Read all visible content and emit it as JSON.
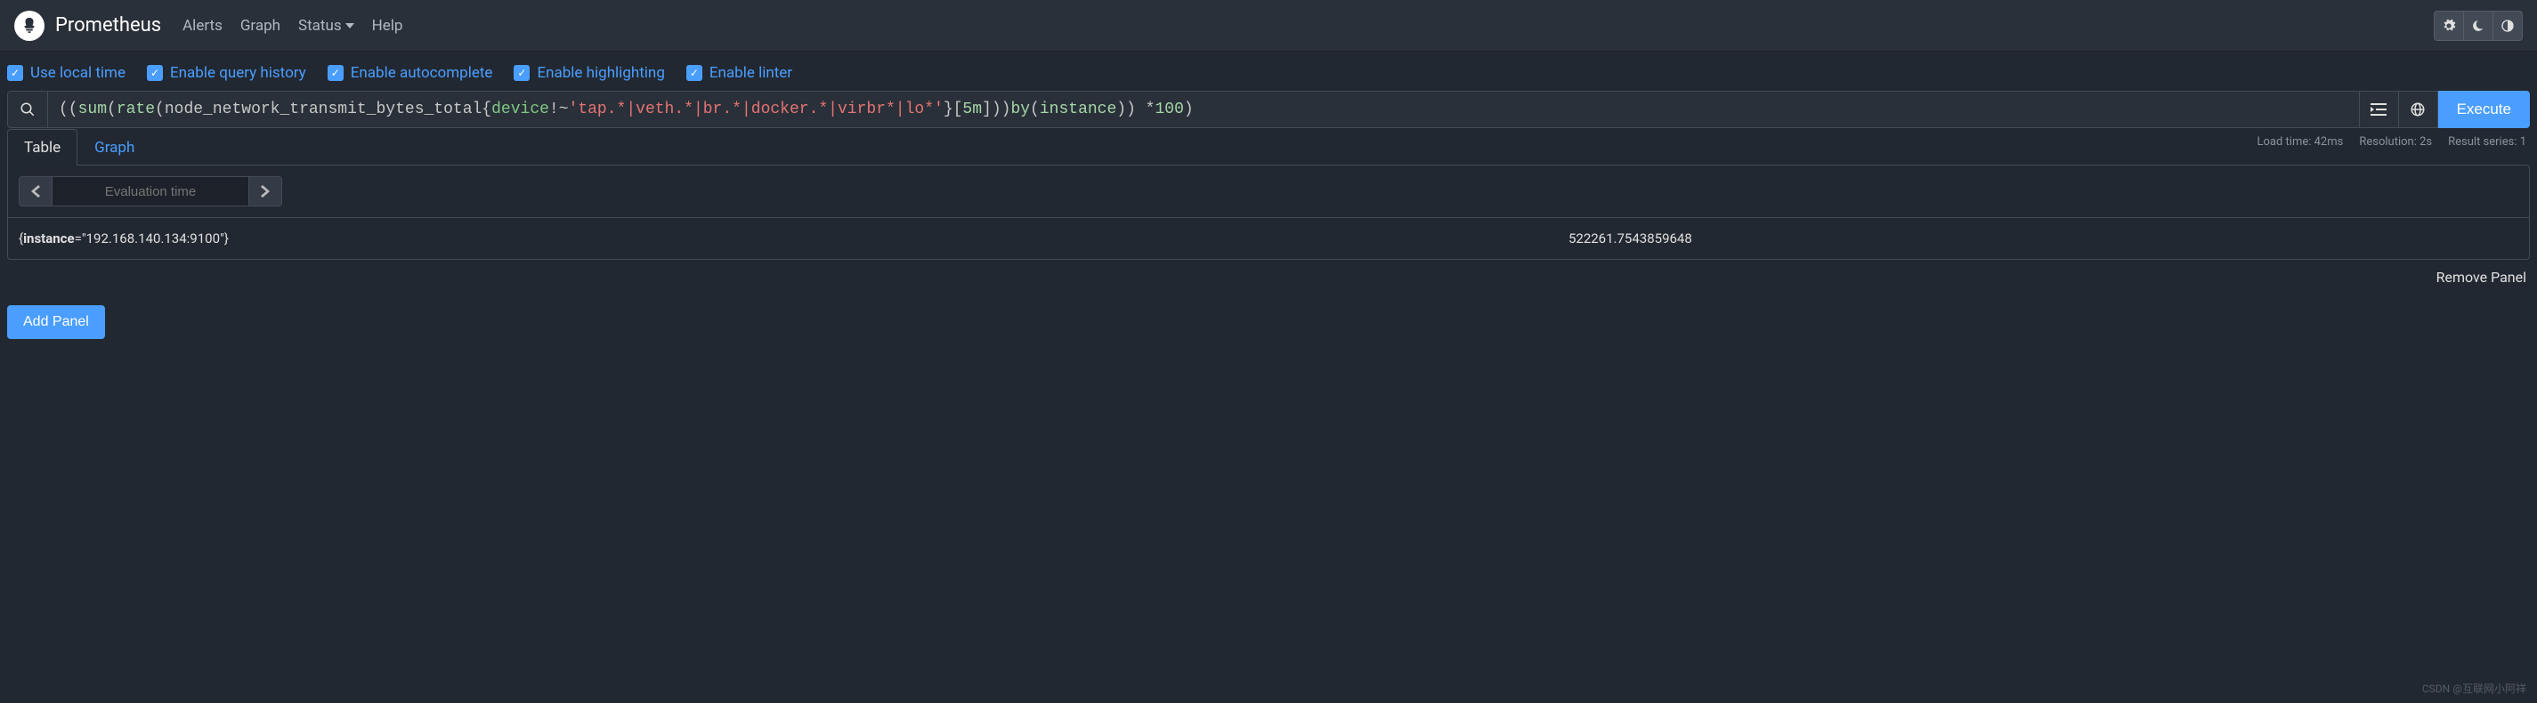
{
  "header": {
    "brand": "Prometheus",
    "nav": {
      "alerts": "Alerts",
      "graph": "Graph",
      "status": "Status",
      "help": "Help"
    }
  },
  "options": {
    "local_time": {
      "checked": true,
      "label": "Use local time"
    },
    "query_history": {
      "checked": true,
      "label": "Enable query history"
    },
    "autocomplete": {
      "checked": true,
      "label": "Enable autocomplete"
    },
    "highlighting": {
      "checked": true,
      "label": "Enable highlighting"
    },
    "linter": {
      "checked": true,
      "label": "Enable linter"
    }
  },
  "query": {
    "tokens": {
      "t0": "((",
      "t1": "sum",
      "t2": "(",
      "t3": "rate",
      "t4": " (node_network_transmit_bytes_total{",
      "t5": "device",
      "t6": "!~",
      "t7": "'tap.*|veth.*|br.*|docker.*|virbr*|lo*'",
      "t8": "}[",
      "t9": "5m",
      "t10": "])) ",
      "t11": "by",
      "t12": " (",
      "t13": "instance",
      "t14": ")) * ",
      "t15": "100",
      "t16": ")"
    },
    "execute_label": "Execute"
  },
  "meta": {
    "load_time": "Load time: 42ms",
    "resolution": "Resolution: 2s",
    "result_series": "Result series: 1"
  },
  "tabs": {
    "table": "Table",
    "graph": "Graph"
  },
  "eval": {
    "placeholder": "Evaluation time"
  },
  "results": [
    {
      "key_prefix": "{",
      "key_b": "instance",
      "key_suffix": "=\"192.168.140.134:9100\"}",
      "value": "522261.7543859648"
    }
  ],
  "actions": {
    "remove_panel": "Remove Panel",
    "add_panel": "Add Panel"
  },
  "watermark": "CSDN @互联网小阿祥"
}
